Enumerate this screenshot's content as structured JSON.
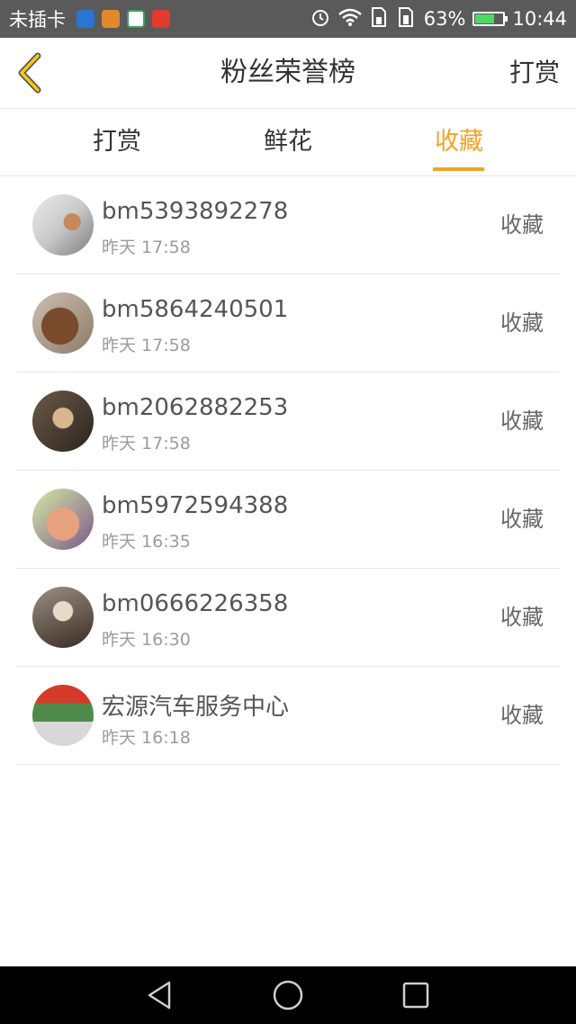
{
  "status_bar": {
    "carrier": "未插卡",
    "battery": "63%",
    "time": "10:44",
    "battery_level": 0.63,
    "icons": [
      "shield-app-icon",
      "tools-app-icon",
      "browser-app-icon",
      "weibo-app-icon",
      "alarm-icon",
      "wifi-icon",
      "sim1-icon",
      "sim2-icon",
      "battery-icon"
    ]
  },
  "header": {
    "title": "粉丝荣誉榜",
    "action": "打赏",
    "back_icon": "chevron-left-icon",
    "accent_color": "#f3a326"
  },
  "tabs": [
    {
      "label": "打赏",
      "active": false
    },
    {
      "label": "鲜花",
      "active": false
    },
    {
      "label": "收藏",
      "active": true
    }
  ],
  "fans": [
    {
      "name": "bm5393892278",
      "time": "昨天 17:58",
      "action": "收藏"
    },
    {
      "name": "bm5864240501",
      "time": "昨天 17:58",
      "action": "收藏"
    },
    {
      "name": "bm2062882253",
      "time": "昨天 17:58",
      "action": "收藏"
    },
    {
      "name": "bm5972594388",
      "time": "昨天 16:35",
      "action": "收藏"
    },
    {
      "name": "bm0666226358",
      "time": "昨天 16:30",
      "action": "收藏"
    },
    {
      "name": "宏源汽车服务中心",
      "time": "昨天 16:18",
      "action": "收藏"
    }
  ],
  "nav_bar": {
    "icons": [
      "back-triangle-icon",
      "home-circle-icon",
      "recents-square-icon"
    ]
  }
}
